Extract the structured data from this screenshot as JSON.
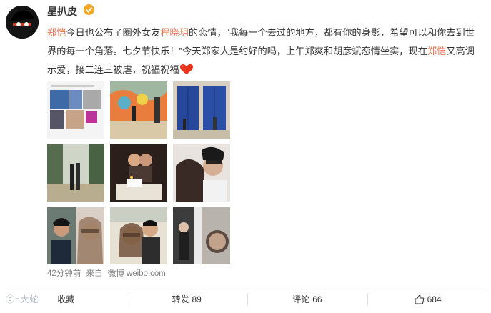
{
  "user": {
    "name": "星扒皮"
  },
  "post": {
    "segments": [
      {
        "text": "郑恺",
        "link": true
      },
      {
        "text": "今日也公布了圈外女友",
        "link": false
      },
      {
        "text": "程晓玥",
        "link": true
      },
      {
        "text": "的恋情，“我每一个去过的地方，都有你的身影，希望可以和你去到世界的每一个角落。七夕节快乐！”今天郑家人是约好的吗，上午郑爽和胡彦斌恋情坐实，现在",
        "link": false
      },
      {
        "text": "郑恺",
        "link": true
      },
      {
        "text": "又高调示爱，接二连三被虐，祝福祝福",
        "link": false
      }
    ],
    "photo_count": 9
  },
  "meta": {
    "time": "42分钟前",
    "source_prefix": "来自",
    "source": "微博 weibo.com"
  },
  "actions": {
    "favorite": "收藏",
    "repost": "转发",
    "repost_count": "89",
    "comment": "评论",
    "comment_count": "66",
    "like_count": "684"
  },
  "watermark": "大蛇"
}
